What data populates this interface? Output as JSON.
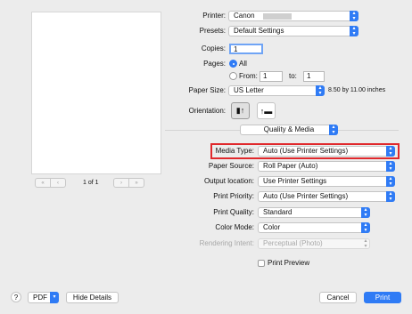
{
  "preview": {
    "page_indicator": "1 of 1",
    "first": "«",
    "prev": "‹",
    "next": "›",
    "last": "»"
  },
  "top": {
    "printer_label": "Printer:",
    "printer_value": "Canon",
    "presets_label": "Presets:",
    "presets_value": "Default Settings",
    "copies_label": "Copies:",
    "copies_value": "1",
    "pages_label": "Pages:",
    "pages_all": "All",
    "pages_from": "From:",
    "from_value": "1",
    "to_label": "to:",
    "to_value": "1",
    "paper_size_label": "Paper Size:",
    "paper_size_value": "US Letter",
    "paper_dims": "8.50 by 11.00 inches",
    "orientation_label": "Orientation:"
  },
  "section": {
    "value": "Quality & Media"
  },
  "settings": {
    "media_type_label": "Media Type:",
    "media_type_value": "Auto (Use Printer Settings)",
    "paper_source_label": "Paper Source:",
    "paper_source_value": "Roll Paper (Auto)",
    "output_location_label": "Output location:",
    "output_location_value": "Use Printer Settings",
    "print_priority_label": "Print Priority:",
    "print_priority_value": "Auto (Use Printer Settings)",
    "print_quality_label": "Print Quality:",
    "print_quality_value": "Standard",
    "color_mode_label": "Color Mode:",
    "color_mode_value": "Color",
    "rendering_intent_label": "Rendering Intent:",
    "rendering_intent_value": "Perceptual (Photo)",
    "print_preview_label": "Print Preview"
  },
  "footer": {
    "help": "?",
    "pdf": "PDF",
    "hide_details": "Hide Details",
    "cancel": "Cancel",
    "print": "Print"
  },
  "colors": {
    "accent": "#2f7bf5",
    "highlight": "#e0282c"
  }
}
